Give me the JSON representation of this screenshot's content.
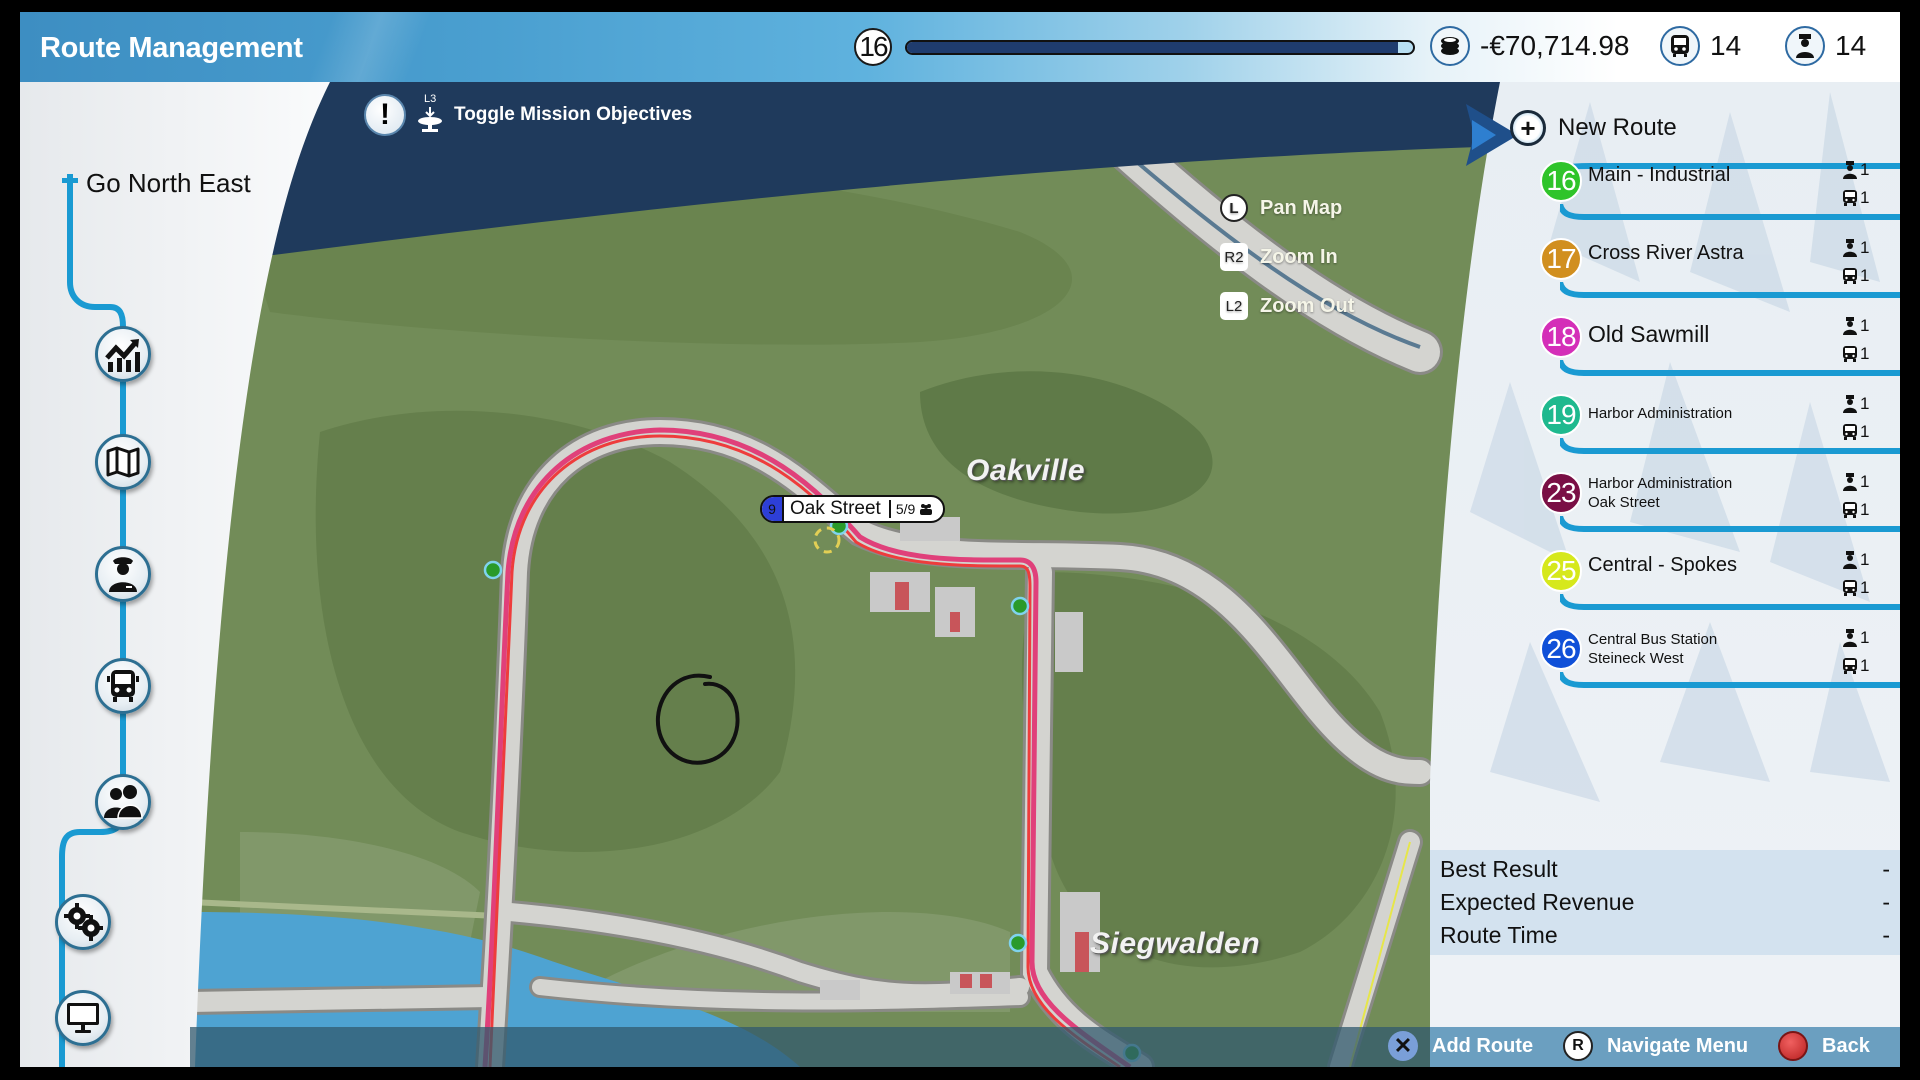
{
  "header": {
    "title": "Route Management",
    "level": "16",
    "level_progress_percent": 97,
    "money": "-€70,714.98",
    "buses": "14",
    "drivers": "14"
  },
  "mission": {
    "stick_hint": "L3",
    "label": "Toggle Mission Objectives"
  },
  "sidebar": {
    "company": "Go North East",
    "items": [
      {
        "icon": "statistics-icon",
        "label": "Statistics"
      },
      {
        "icon": "map-icon",
        "label": "Map"
      },
      {
        "icon": "driver-icon",
        "label": "Drivers"
      },
      {
        "icon": "bus-icon",
        "label": "Buses"
      },
      {
        "icon": "passengers-icon",
        "label": "Passengers"
      },
      {
        "icon": "settings-icon",
        "label": "Settings"
      },
      {
        "icon": "monitor-icon",
        "label": "Display"
      }
    ]
  },
  "map_controls": [
    {
      "key": "L",
      "label": "Pan Map"
    },
    {
      "key": "R2",
      "label": "Zoom In"
    },
    {
      "key": "L2",
      "label": "Zoom Out"
    }
  ],
  "map": {
    "places": [
      "Oakville",
      "Siegwalden"
    ],
    "stop_tooltip": {
      "number": "9",
      "name": "Oak Street",
      "capacity": "5/9"
    },
    "annotation": "O"
  },
  "routes_panel": {
    "new_route_label": "New Route",
    "routes": [
      {
        "number": "16",
        "color": "#2fc42a",
        "name_lines": [
          "Main - Industrial"
        ],
        "drivers": "1",
        "buses": "1"
      },
      {
        "number": "17",
        "color": "#d18f1f",
        "name_lines": [
          "Cross River Astra"
        ],
        "drivers": "1",
        "buses": "1"
      },
      {
        "number": "18",
        "color": "#d42fb8",
        "name_lines": [
          "Old Sawmill"
        ],
        "drivers": "1",
        "buses": "1"
      },
      {
        "number": "19",
        "color": "#1fb98e",
        "name_lines": [
          "Harbor Administration"
        ],
        "drivers": "1",
        "buses": "1"
      },
      {
        "number": "23",
        "color": "#7a0f45",
        "name_lines": [
          "Harbor Administration",
          "Oak Street"
        ],
        "drivers": "1",
        "buses": "1"
      },
      {
        "number": "25",
        "color": "#d6e81c",
        "name_lines": [
          "Central - Spokes"
        ],
        "drivers": "1",
        "buses": "1"
      },
      {
        "number": "26",
        "color": "#1050d8",
        "name_lines": [
          "Central Bus Station",
          "Steineck West"
        ],
        "drivers": "1",
        "buses": "1"
      }
    ],
    "stats": [
      {
        "label": "Best Result",
        "value": "-"
      },
      {
        "label": "Expected Revenue",
        "value": "-"
      },
      {
        "label": "Route Time",
        "value": "-"
      }
    ]
  },
  "bottom_bar": {
    "add_route": "Add Route",
    "add_route_key": "✕",
    "navigate_menu": "Navigate Menu",
    "navigate_key": "R",
    "back": "Back"
  }
}
